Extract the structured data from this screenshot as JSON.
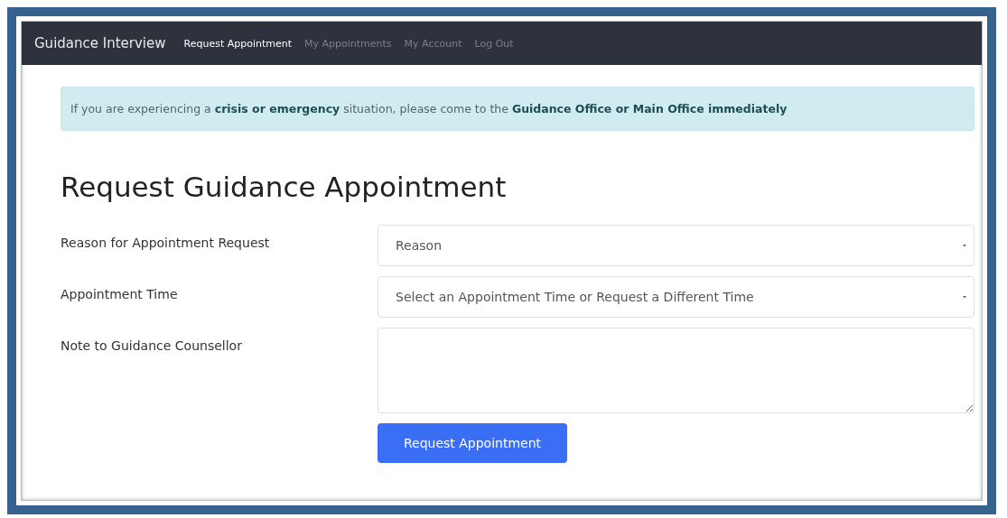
{
  "navbar": {
    "brand": "Guidance Interview",
    "items": [
      {
        "label": "Request Appointment",
        "selected": true
      },
      {
        "label": "My Appointments",
        "selected": false
      },
      {
        "label": "My Account",
        "selected": false
      },
      {
        "label": "Log Out",
        "selected": false
      }
    ]
  },
  "alert": "If you are experiencing a **crisis or emergency** situation, please come to the **Guidance Office or Main Office immediately**",
  "heading": "Request Guidance Appointment",
  "fields": [
    {
      "label": "Reason for Appointment Request",
      "kind": "select",
      "placeholder": "Reason"
    },
    {
      "label": "Appointment Time",
      "kind": "select",
      "placeholder": "Select an Appointment Time or Request a Different Time"
    },
    {
      "label": "Note to Guidance Counsellor",
      "kind": "textarea"
    }
  ],
  "submit": "Request Appointment"
}
